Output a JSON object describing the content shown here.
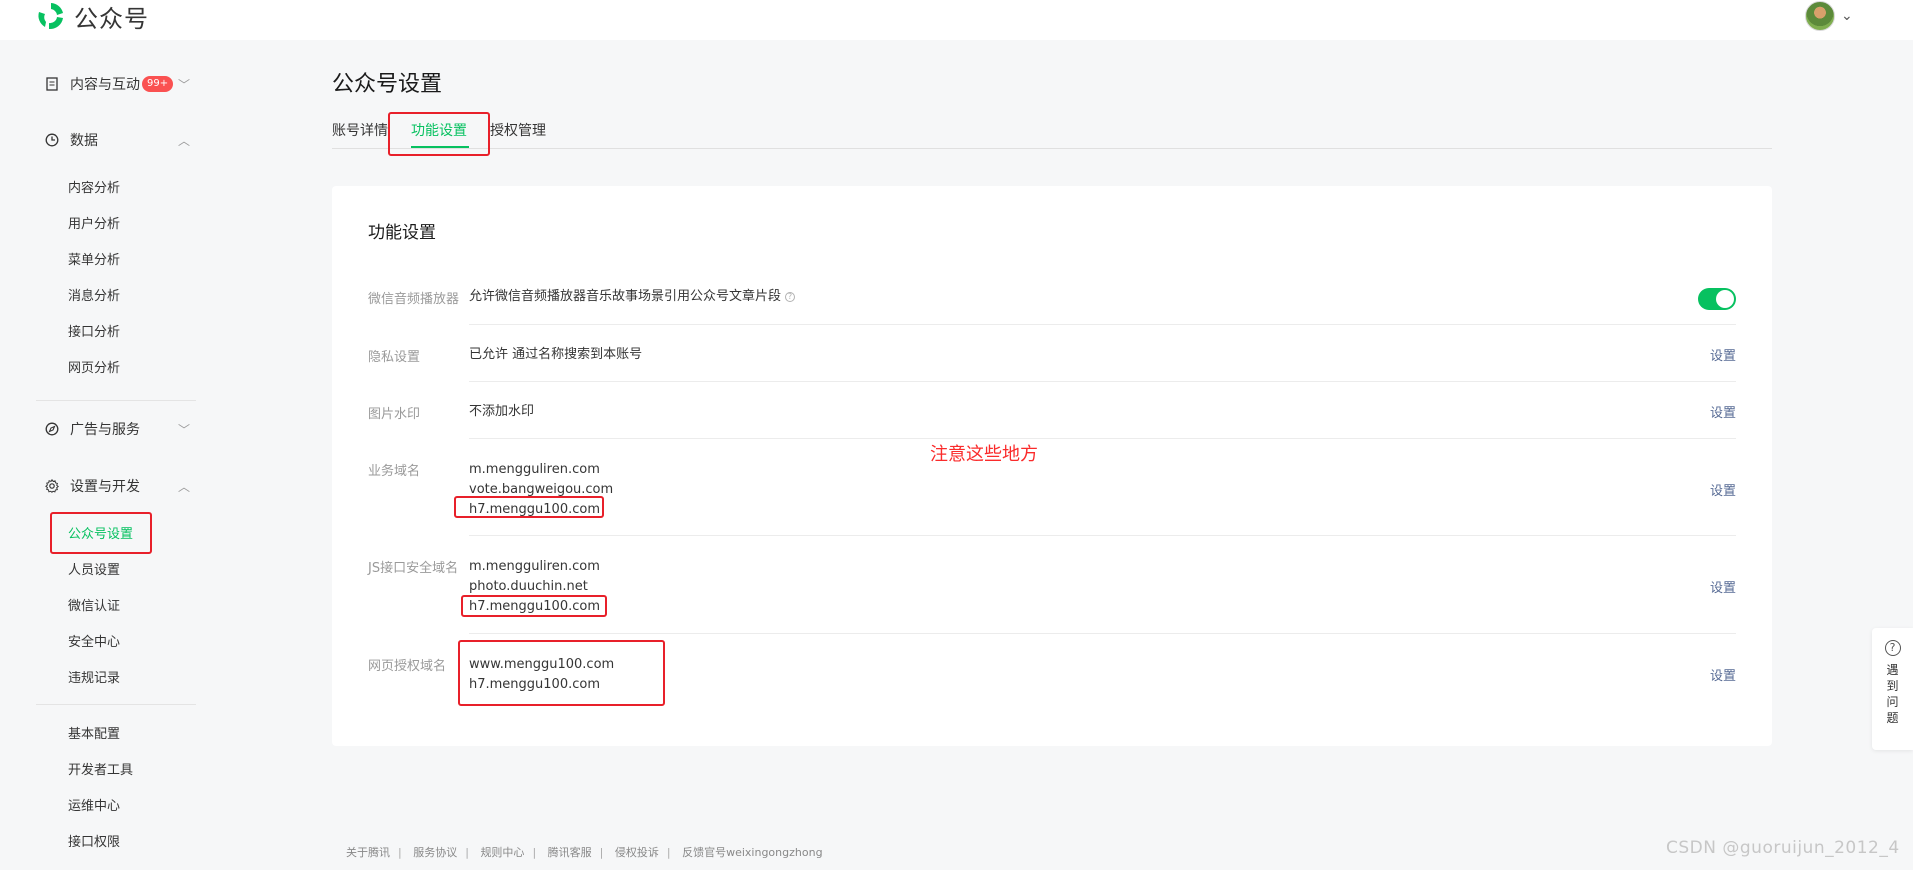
{
  "header": {
    "logo_text": "公众号"
  },
  "sidebar": {
    "groups": [
      {
        "label": "内容与互动",
        "badge": "99+",
        "icon": "document-icon",
        "expanded": false
      },
      {
        "label": "数据",
        "icon": "clock-icon",
        "expanded": true,
        "items": [
          "内容分析",
          "用户分析",
          "菜单分析",
          "消息分析",
          "接口分析",
          "网页分析"
        ]
      },
      {
        "label": "广告与服务",
        "icon": "compass-icon",
        "expanded": false
      },
      {
        "label": "设置与开发",
        "icon": "gear-icon",
        "expanded": true,
        "items": [
          "公众号设置",
          "人员设置",
          "微信认证",
          "安全中心",
          "违规记录"
        ],
        "active": "公众号设置"
      },
      {
        "items": [
          "基本配置",
          "开发者工具",
          "运维中心",
          "接口权限"
        ]
      }
    ]
  },
  "main": {
    "page_title": "公众号设置",
    "tabs": [
      "账号详情",
      "功能设置",
      "授权管理"
    ],
    "active_tab": "功能设置",
    "card": {
      "title": "功能设置",
      "rows": [
        {
          "label": "微信音频播放器",
          "value": "允许微信音频播放器音乐故事场景引用公众号文章片段",
          "help": "?",
          "toggle_on": true
        },
        {
          "label": "隐私设置",
          "value": "已允许 通过名称搜索到本账号",
          "action": "设置"
        },
        {
          "label": "图片水印",
          "value": "不添加水印",
          "action": "设置"
        },
        {
          "label": "业务域名",
          "values": [
            "m.mengguliren.com",
            "vote.bangweigou.com",
            "h7.menggu100.com"
          ],
          "action": "设置"
        },
        {
          "label": "JS接口安全域名",
          "values": [
            "m.mengguliren.com",
            "photo.duuchin.net",
            "h7.menggu100.com"
          ],
          "action": "设置"
        },
        {
          "label": "网页授权域名",
          "values": [
            "www.menggu100.com",
            "h7.menggu100.com"
          ],
          "action": "设置"
        }
      ],
      "note": "注意这些地方"
    }
  },
  "footer": {
    "links": [
      "关于腾讯",
      "服务协议",
      "规则中心",
      "腾讯客服",
      "侵权投诉",
      "反馈官号weixingongzhong"
    ]
  },
  "float_help": {
    "text": "遇到问题",
    "icon": "?"
  },
  "watermark": "CSDN @guoruijun_2012_4",
  "colors": {
    "brand_green": "#07c160",
    "link_blue": "#576b95",
    "annotation_red": "#e8202a"
  }
}
